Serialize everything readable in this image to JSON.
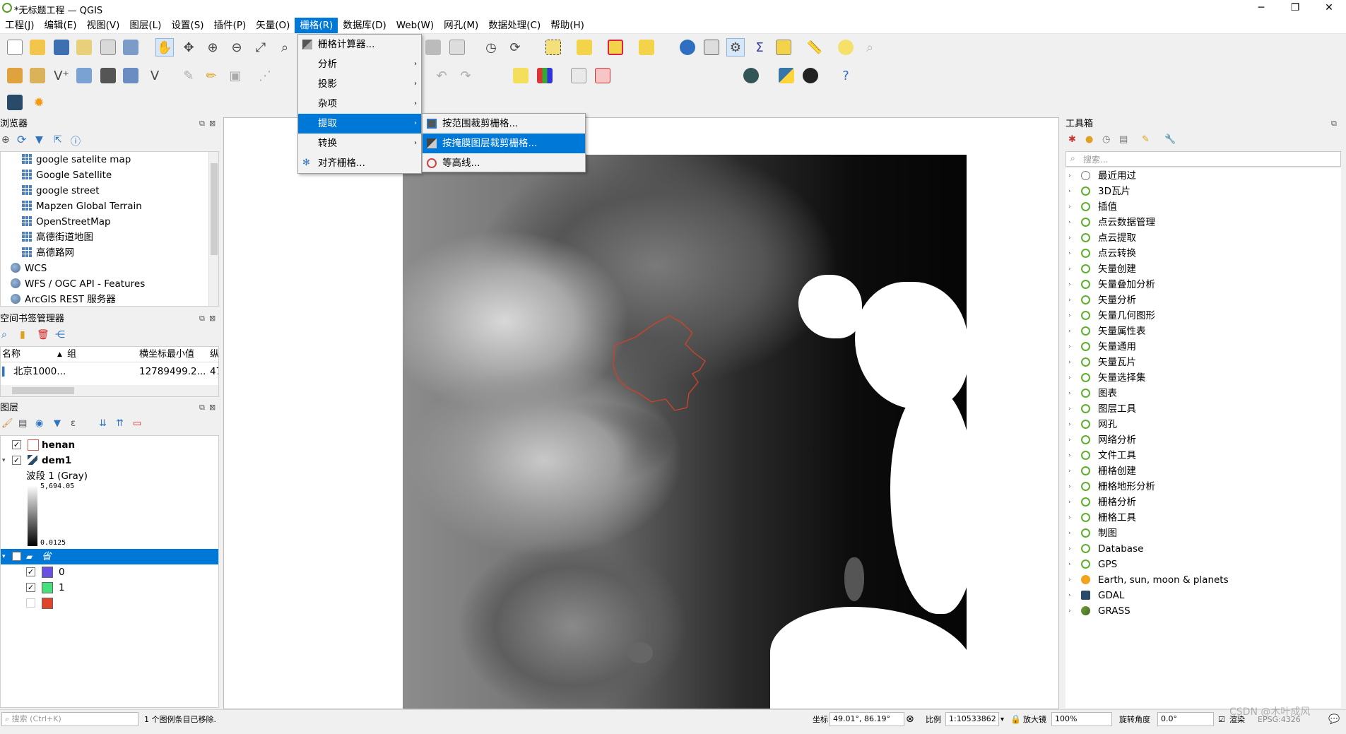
{
  "window": {
    "title": "*无标题工程 — QGIS",
    "minimize": "─",
    "restore": "❐",
    "close": "✕"
  },
  "menubar": [
    {
      "label": "工程(J)"
    },
    {
      "label": "编辑(E)"
    },
    {
      "label": "视图(V)"
    },
    {
      "label": "图层(L)"
    },
    {
      "label": "设置(S)"
    },
    {
      "label": "插件(P)"
    },
    {
      "label": "矢量(O)"
    },
    {
      "label": "栅格(R)"
    },
    {
      "label": "数据库(D)"
    },
    {
      "label": "Web(W)"
    },
    {
      "label": "网孔(M)"
    },
    {
      "label": "数据处理(C)"
    },
    {
      "label": "帮助(H)"
    }
  ],
  "raster_menu": {
    "items": [
      {
        "label": "栅格计算器..."
      },
      {
        "label": "分析"
      },
      {
        "label": "投影"
      },
      {
        "label": "杂项"
      },
      {
        "label": "提取"
      },
      {
        "label": "转换"
      },
      {
        "label": "对齐栅格..."
      }
    ],
    "submenu_arrow": "›"
  },
  "extract_submenu": {
    "items": [
      {
        "label": "按范围裁剪栅格..."
      },
      {
        "label": "按掩膜图层裁剪栅格..."
      },
      {
        "label": "等高线..."
      }
    ]
  },
  "browser": {
    "title": "浏览器",
    "items": [
      {
        "label": "google satelite map",
        "type": "grid"
      },
      {
        "label": "Google Satellite",
        "type": "grid"
      },
      {
        "label": "google street",
        "type": "grid"
      },
      {
        "label": "Mapzen Global Terrain",
        "type": "grid"
      },
      {
        "label": "OpenStreetMap",
        "type": "grid"
      },
      {
        "label": "高德街道地图",
        "type": "grid"
      },
      {
        "label": "高德路网",
        "type": "grid"
      },
      {
        "label": "WCS",
        "type": "globe"
      },
      {
        "label": "WFS / OGC API - Features",
        "type": "globe"
      },
      {
        "label": "ArcGIS REST 服务器",
        "type": "globe"
      }
    ]
  },
  "bookmarks": {
    "title": "空间书签管理器",
    "columns": [
      "名称",
      "组",
      "横坐标最小值",
      "纵"
    ],
    "rows": [
      {
        "name": "北京1000...",
        "group": "",
        "xmin": "12789499.2...",
        "y": "47"
      }
    ]
  },
  "layers": {
    "title": "图层",
    "henan": "henan",
    "dem1": "dem1",
    "band": "波段 1 (Gray)",
    "max": "5,694.05",
    "min": "0.0125",
    "group_layer": "省",
    "class0": "0",
    "class1": "1",
    "colors": {
      "class0": "#6b4fe0",
      "class1": "#45e07a",
      "class2": "#e0452c"
    }
  },
  "toolbox": {
    "title": "工具箱",
    "search_placeholder": "搜索...",
    "items": [
      {
        "label": "最近用过",
        "icon": "clock"
      },
      {
        "label": "3D瓦片",
        "icon": "q"
      },
      {
        "label": "插值",
        "icon": "q"
      },
      {
        "label": "点云数据管理",
        "icon": "q"
      },
      {
        "label": "点云提取",
        "icon": "q"
      },
      {
        "label": "点云转换",
        "icon": "q"
      },
      {
        "label": "矢量创建",
        "icon": "q"
      },
      {
        "label": "矢量叠加分析",
        "icon": "q"
      },
      {
        "label": "矢量分析",
        "icon": "q"
      },
      {
        "label": "矢量几何图形",
        "icon": "q"
      },
      {
        "label": "矢量属性表",
        "icon": "q"
      },
      {
        "label": "矢量通用",
        "icon": "q"
      },
      {
        "label": "矢量瓦片",
        "icon": "q"
      },
      {
        "label": "矢量选择集",
        "icon": "q"
      },
      {
        "label": "图表",
        "icon": "q"
      },
      {
        "label": "图层工具",
        "icon": "q"
      },
      {
        "label": "网孔",
        "icon": "q"
      },
      {
        "label": "网络分析",
        "icon": "q"
      },
      {
        "label": "文件工具",
        "icon": "q"
      },
      {
        "label": "栅格创建",
        "icon": "q"
      },
      {
        "label": "栅格地形分析",
        "icon": "q"
      },
      {
        "label": "栅格分析",
        "icon": "q"
      },
      {
        "label": "栅格工具",
        "icon": "q"
      },
      {
        "label": "制图",
        "icon": "q"
      },
      {
        "label": "Database",
        "icon": "q"
      },
      {
        "label": "GPS",
        "icon": "q"
      },
      {
        "label": "Earth, sun, moon & planets",
        "icon": "sun"
      },
      {
        "label": "GDAL",
        "icon": "gdal"
      },
      {
        "label": "GRASS",
        "icon": "grass"
      }
    ]
  },
  "statusbar": {
    "search_placeholder": "搜索 (Ctrl+K)",
    "message": "1 个图例条目已移除.",
    "coord_label": "坐标",
    "coord_value": "49.01°, 86.19°",
    "scale_label": "比例",
    "scale_value": "1:10533862",
    "magnifier_label": "放大镜",
    "magnifier_value": "100%",
    "rotation_label": "旋转角度",
    "rotation_value": "0.0°",
    "render_label": "渲染",
    "crs_value": "EPSG:4326",
    "watermark": "CSDN @木叶成风"
  }
}
